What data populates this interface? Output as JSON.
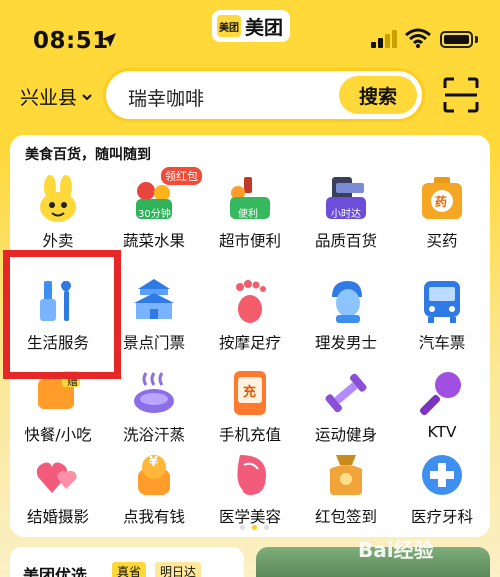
{
  "status_bar": {
    "time": "08:51"
  },
  "app_badge": {
    "logo_small": "美团",
    "logo_text": "美团"
  },
  "location": {
    "label": "兴业县"
  },
  "search": {
    "value": "瑞幸咖啡",
    "button_label": "搜索"
  },
  "card": {
    "subtitle": "美食百货，随叫随到",
    "row1": [
      {
        "label": "外卖",
        "icon": "rabbit-icon"
      },
      {
        "label": "蔬菜水果",
        "icon": "fruit-basket-icon",
        "badge": "领红包",
        "sub_badge": "30分钟"
      },
      {
        "label": "超市便利",
        "icon": "grocery-basket-icon",
        "sub_badge": "便利"
      },
      {
        "label": "品质百货",
        "icon": "shopping-bag-icon",
        "sub_badge": "小时达"
      },
      {
        "label": "买药",
        "icon": "medicine-box-icon",
        "sub_badge": "药"
      }
    ],
    "row2": [
      {
        "label": "生活服务",
        "icon": "tools-icon"
      },
      {
        "label": "景点门票",
        "icon": "temple-icon"
      },
      {
        "label": "按摩足疗",
        "icon": "foot-icon"
      },
      {
        "label": "理发男士",
        "icon": "man-head-icon"
      },
      {
        "label": "汽车票",
        "icon": "bus-icon"
      }
    ],
    "row3": [
      {
        "label": "快餐/小吃",
        "icon": "snack-icon",
        "sub_badge": "赠"
      },
      {
        "label": "洗浴汗蒸",
        "icon": "spa-icon"
      },
      {
        "label": "手机充值",
        "icon": "recharge-icon",
        "sub_badge": "充"
      },
      {
        "label": "运动健身",
        "icon": "dumbbell-icon"
      },
      {
        "label": "KTV",
        "icon": "microphone-icon"
      }
    ],
    "row4": [
      {
        "label": "结婚摄影",
        "icon": "hearts-icon"
      },
      {
        "label": "点我有钱",
        "icon": "coin-icon",
        "sub_badge": "¥"
      },
      {
        "label": "医学美容",
        "icon": "beauty-icon"
      },
      {
        "label": "红包签到",
        "icon": "red-packet-icon"
      },
      {
        "label": "医疗牙科",
        "icon": "medical-cross-icon"
      }
    ]
  },
  "bottom": {
    "left_title": "美团优选",
    "left_tag1": "真省",
    "left_tag2": "明日达"
  },
  "watermark": "Bai经验",
  "colors": {
    "brand_yellow": "#ffd83a",
    "highlight_red": "#e52727"
  }
}
